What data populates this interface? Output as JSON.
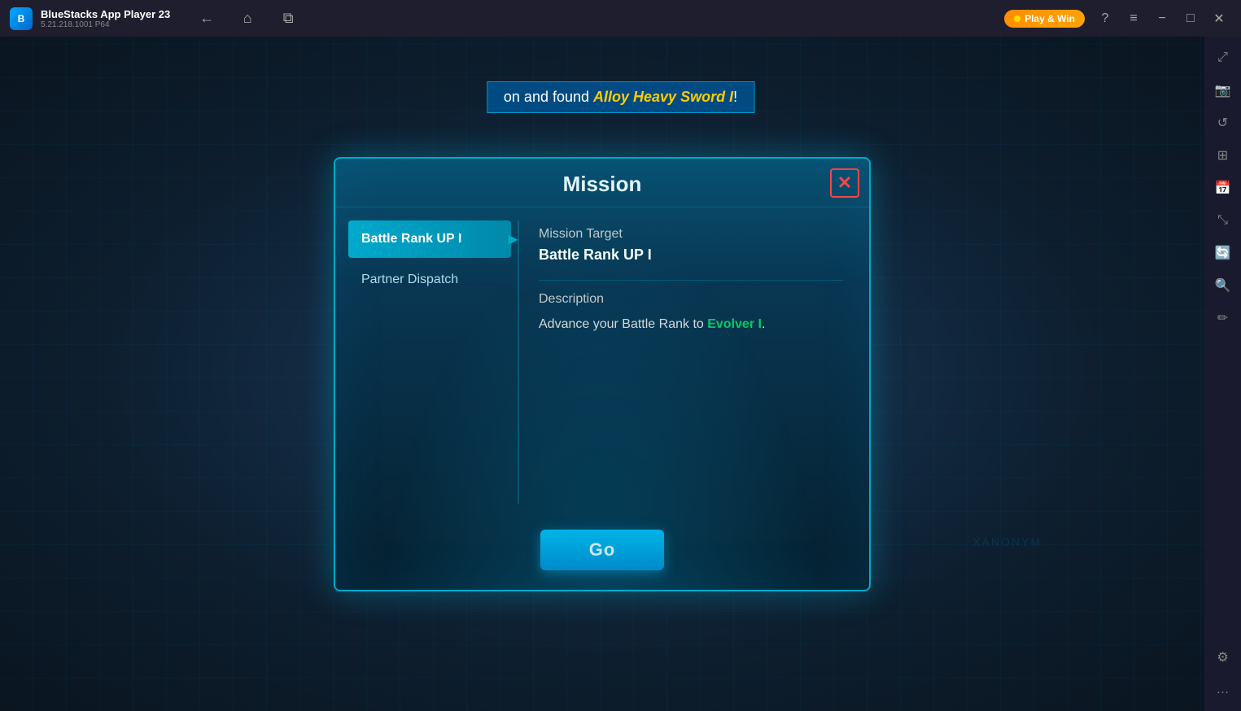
{
  "titlebar": {
    "app_name": "BlueStacks App Player 23",
    "app_version": "5.21.218.1001 P64",
    "back_label": "←",
    "home_label": "⌂",
    "multi_label": "⧉",
    "play_win_label": "Play & Win",
    "help_label": "?",
    "menu_label": "≡",
    "minimize_label": "−",
    "maximize_label": "□",
    "close_label": "✕",
    "expand_label": "⤢"
  },
  "notification": {
    "text_before": "on and found ",
    "highlight": "Alloy Heavy Sword I",
    "text_after": "!"
  },
  "sidebar_icons": [
    "⤢",
    "📸",
    "↺",
    "⊞",
    "📅",
    "⤡",
    "⚙",
    "🔍",
    "✏",
    "…"
  ],
  "dialog": {
    "title": "Mission",
    "close_label": "✕",
    "mission_list": [
      {
        "id": "battle-rank-up",
        "label": "Battle Rank UP I",
        "active": true
      },
      {
        "id": "partner-dispatch",
        "label": "Partner Dispatch",
        "active": false
      }
    ],
    "detail": {
      "section_target_title": "Mission Target",
      "section_target_value": "Battle Rank UP I",
      "section_desc_title": "Description",
      "section_desc_before": "Advance your Battle Rank to ",
      "section_desc_highlight": "Evolver I",
      "section_desc_after": "."
    },
    "go_button_label": "Go"
  }
}
